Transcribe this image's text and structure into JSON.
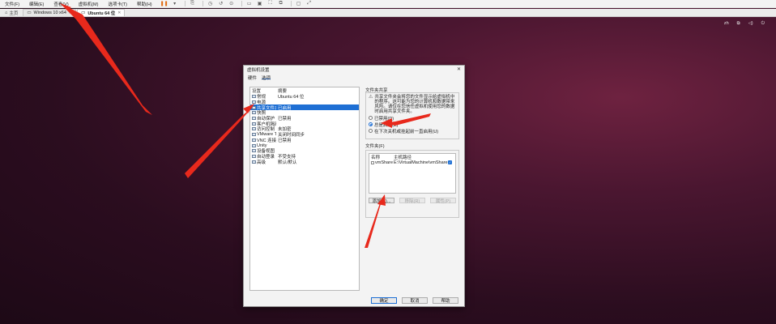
{
  "menubar": {
    "items": [
      "文件(F)",
      "编辑(E)",
      "查看(V)",
      "虚拟机(M)",
      "选项卡(T)",
      "帮助(H)"
    ]
  },
  "tabs": {
    "home": "主页",
    "vms": [
      {
        "label": "Windows 10 x64",
        "active": false
      },
      {
        "label": "Ubuntu 64 位",
        "active": true
      }
    ]
  },
  "ubuntu_bar": {
    "lang": "zh"
  },
  "dialog": {
    "title": "虚拟机设置",
    "tabs": [
      "硬件",
      "选项"
    ],
    "list": {
      "headers": [
        "设置",
        "摘要"
      ],
      "rows": [
        {
          "name": "常规",
          "summary": "Ubuntu 64 位",
          "selected": false
        },
        {
          "name": "电源",
          "summary": "",
          "selected": false
        },
        {
          "name": "共享文件夹",
          "summary": "已启用",
          "selected": true
        },
        {
          "name": "快照",
          "summary": "",
          "selected": false
        },
        {
          "name": "自动保护",
          "summary": "已禁用",
          "selected": false
        },
        {
          "name": "客户机隔离",
          "summary": "",
          "selected": false
        },
        {
          "name": "访问控制",
          "summary": "未加密",
          "selected": false
        },
        {
          "name": "VMware Tools",
          "summary": "关闭时间同步",
          "selected": false
        },
        {
          "name": "VNC 连接",
          "summary": "已禁用",
          "selected": false
        },
        {
          "name": "Unity",
          "summary": "",
          "selected": false
        },
        {
          "name": "设备视图",
          "summary": "",
          "selected": false
        },
        {
          "name": "自动登录",
          "summary": "不受支持",
          "selected": false
        },
        {
          "name": "高级",
          "summary": "默认/默认",
          "selected": false
        }
      ]
    },
    "sharing": {
      "group": "文件夹共享",
      "info": "共享文件夹会将您的文件显示给虚拟机中的程序。这可能为您的计算机和数据带来风险。请仅在您信任虚拟机使用您的数据时启用共享文件夹。",
      "options": [
        {
          "label": "已禁用(D)",
          "checked": false
        },
        {
          "label": "总是启用(E)",
          "checked": true
        },
        {
          "label": "在下次关机或挂起前一直启用(U)",
          "checked": false
        }
      ]
    },
    "folders": {
      "group": "文件夹(F)",
      "headers": [
        "名称",
        "主机路径"
      ],
      "rows": [
        {
          "name": "vmShare",
          "path": "E:\\VirtualMachine\\vmShare"
        }
      ],
      "add": "添加(A)...",
      "remove": "移除(R)",
      "properties": "属性(P)"
    },
    "footer": {
      "ok": "确定",
      "cancel": "取消",
      "help": "帮助"
    }
  }
}
